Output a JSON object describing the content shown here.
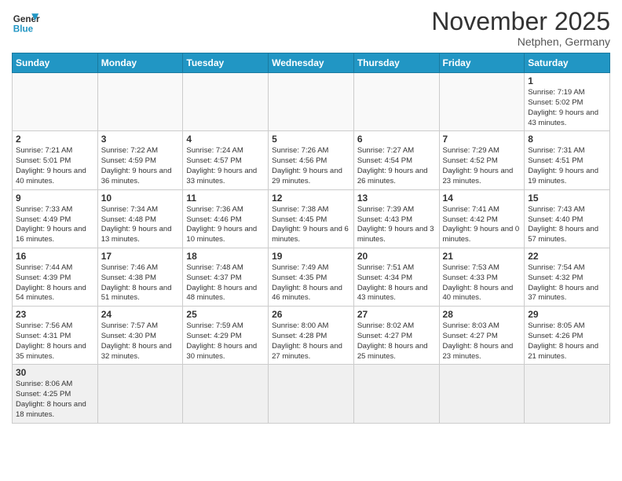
{
  "logo": {
    "line1": "General",
    "line2": "Blue"
  },
  "title": "November 2025",
  "subtitle": "Netphen, Germany",
  "days_header": [
    "Sunday",
    "Monday",
    "Tuesday",
    "Wednesday",
    "Thursday",
    "Friday",
    "Saturday"
  ],
  "weeks": [
    {
      "cells": [
        {
          "day": "",
          "info": "",
          "empty": true
        },
        {
          "day": "",
          "info": "",
          "empty": true
        },
        {
          "day": "",
          "info": "",
          "empty": true
        },
        {
          "day": "",
          "info": "",
          "empty": true
        },
        {
          "day": "",
          "info": "",
          "empty": true
        },
        {
          "day": "",
          "info": "",
          "empty": true
        },
        {
          "day": "1",
          "info": "Sunrise: 7:19 AM\nSunset: 5:02 PM\nDaylight: 9 hours\nand 43 minutes."
        }
      ]
    },
    {
      "cells": [
        {
          "day": "2",
          "info": "Sunrise: 7:21 AM\nSunset: 5:01 PM\nDaylight: 9 hours\nand 40 minutes."
        },
        {
          "day": "3",
          "info": "Sunrise: 7:22 AM\nSunset: 4:59 PM\nDaylight: 9 hours\nand 36 minutes."
        },
        {
          "day": "4",
          "info": "Sunrise: 7:24 AM\nSunset: 4:57 PM\nDaylight: 9 hours\nand 33 minutes."
        },
        {
          "day": "5",
          "info": "Sunrise: 7:26 AM\nSunset: 4:56 PM\nDaylight: 9 hours\nand 29 minutes."
        },
        {
          "day": "6",
          "info": "Sunrise: 7:27 AM\nSunset: 4:54 PM\nDaylight: 9 hours\nand 26 minutes."
        },
        {
          "day": "7",
          "info": "Sunrise: 7:29 AM\nSunset: 4:52 PM\nDaylight: 9 hours\nand 23 minutes."
        },
        {
          "day": "8",
          "info": "Sunrise: 7:31 AM\nSunset: 4:51 PM\nDaylight: 9 hours\nand 19 minutes."
        }
      ]
    },
    {
      "cells": [
        {
          "day": "9",
          "info": "Sunrise: 7:33 AM\nSunset: 4:49 PM\nDaylight: 9 hours\nand 16 minutes."
        },
        {
          "day": "10",
          "info": "Sunrise: 7:34 AM\nSunset: 4:48 PM\nDaylight: 9 hours\nand 13 minutes."
        },
        {
          "day": "11",
          "info": "Sunrise: 7:36 AM\nSunset: 4:46 PM\nDaylight: 9 hours\nand 10 minutes."
        },
        {
          "day": "12",
          "info": "Sunrise: 7:38 AM\nSunset: 4:45 PM\nDaylight: 9 hours\nand 6 minutes."
        },
        {
          "day": "13",
          "info": "Sunrise: 7:39 AM\nSunset: 4:43 PM\nDaylight: 9 hours\nand 3 minutes."
        },
        {
          "day": "14",
          "info": "Sunrise: 7:41 AM\nSunset: 4:42 PM\nDaylight: 9 hours\nand 0 minutes."
        },
        {
          "day": "15",
          "info": "Sunrise: 7:43 AM\nSunset: 4:40 PM\nDaylight: 8 hours\nand 57 minutes."
        }
      ]
    },
    {
      "cells": [
        {
          "day": "16",
          "info": "Sunrise: 7:44 AM\nSunset: 4:39 PM\nDaylight: 8 hours\nand 54 minutes."
        },
        {
          "day": "17",
          "info": "Sunrise: 7:46 AM\nSunset: 4:38 PM\nDaylight: 8 hours\nand 51 minutes."
        },
        {
          "day": "18",
          "info": "Sunrise: 7:48 AM\nSunset: 4:37 PM\nDaylight: 8 hours\nand 48 minutes."
        },
        {
          "day": "19",
          "info": "Sunrise: 7:49 AM\nSunset: 4:35 PM\nDaylight: 8 hours\nand 46 minutes."
        },
        {
          "day": "20",
          "info": "Sunrise: 7:51 AM\nSunset: 4:34 PM\nDaylight: 8 hours\nand 43 minutes."
        },
        {
          "day": "21",
          "info": "Sunrise: 7:53 AM\nSunset: 4:33 PM\nDaylight: 8 hours\nand 40 minutes."
        },
        {
          "day": "22",
          "info": "Sunrise: 7:54 AM\nSunset: 4:32 PM\nDaylight: 8 hours\nand 37 minutes."
        }
      ]
    },
    {
      "cells": [
        {
          "day": "23",
          "info": "Sunrise: 7:56 AM\nSunset: 4:31 PM\nDaylight: 8 hours\nand 35 minutes."
        },
        {
          "day": "24",
          "info": "Sunrise: 7:57 AM\nSunset: 4:30 PM\nDaylight: 8 hours\nand 32 minutes."
        },
        {
          "day": "25",
          "info": "Sunrise: 7:59 AM\nSunset: 4:29 PM\nDaylight: 8 hours\nand 30 minutes."
        },
        {
          "day": "26",
          "info": "Sunrise: 8:00 AM\nSunset: 4:28 PM\nDaylight: 8 hours\nand 27 minutes."
        },
        {
          "day": "27",
          "info": "Sunrise: 8:02 AM\nSunset: 4:27 PM\nDaylight: 8 hours\nand 25 minutes."
        },
        {
          "day": "28",
          "info": "Sunrise: 8:03 AM\nSunset: 4:27 PM\nDaylight: 8 hours\nand 23 minutes."
        },
        {
          "day": "29",
          "info": "Sunrise: 8:05 AM\nSunset: 4:26 PM\nDaylight: 8 hours\nand 21 minutes."
        }
      ]
    },
    {
      "cells": [
        {
          "day": "30",
          "info": "Sunrise: 8:06 AM\nSunset: 4:25 PM\nDaylight: 8 hours\nand 18 minutes.",
          "last": true
        },
        {
          "day": "",
          "info": "",
          "empty": true,
          "last": true
        },
        {
          "day": "",
          "info": "",
          "empty": true,
          "last": true
        },
        {
          "day": "",
          "info": "",
          "empty": true,
          "last": true
        },
        {
          "day": "",
          "info": "",
          "empty": true,
          "last": true
        },
        {
          "day": "",
          "info": "",
          "empty": true,
          "last": true
        },
        {
          "day": "",
          "info": "",
          "empty": true,
          "last": true
        }
      ]
    }
  ]
}
